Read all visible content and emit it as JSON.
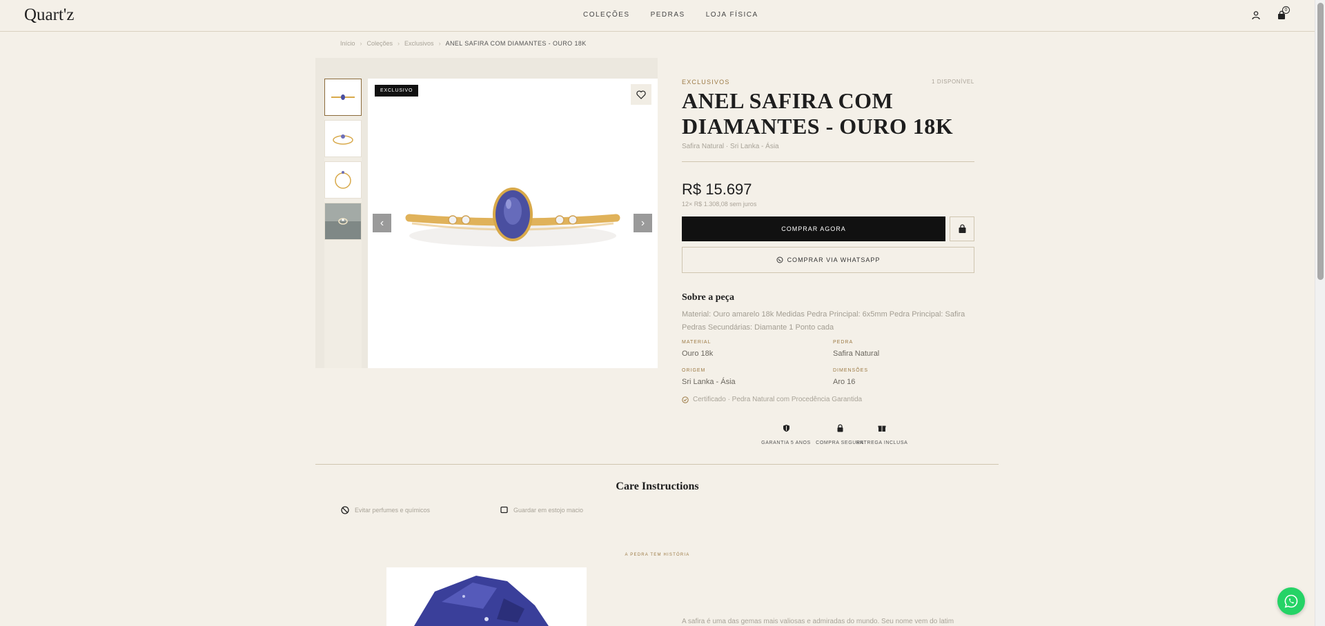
{
  "header": {
    "logo": "Quart'z",
    "nav": [
      "COLEÇÕES",
      "PEDRAS",
      "LOJA FÍSICA"
    ],
    "cart_count": "0"
  },
  "breadcrumb": {
    "items": [
      "Início",
      "Coleções",
      "Exclusivos"
    ],
    "current": "ANEL SAFIRA COM DIAMANTES - OURO 18K"
  },
  "gallery": {
    "badge": "EXCLUSIVO",
    "thumb_count": 4,
    "active_thumb": 1
  },
  "product": {
    "category": "EXCLUSIVOS",
    "availability": "1 DISPONÍVEL",
    "title": "ANEL SAFIRA COM DIAMANTES - OURO 18K",
    "subtitle": "Safira Natural · Sri Lanka - Ásia",
    "price": "R$ 15.697",
    "installments": "12× R$ 1.308,08 sem juros",
    "buy_label": "COMPRAR AGORA",
    "whatsapp_label": "COMPRAR VIA WHATSAPP",
    "about_heading": "Sobre a peça",
    "about_text": "Material: Ouro amarelo 18k Medidas Pedra Principal: 6x5mm Pedra Principal: Safira Pedras Secundárias: Diamante 1 Ponto cada",
    "specs": [
      {
        "label": "MATERIAL",
        "value": "Ouro 18k"
      },
      {
        "label": "PEDRA",
        "value": "Safira Natural"
      },
      {
        "label": "ORIGEM",
        "value": "Sri Lanka - Ásia"
      },
      {
        "label": "DIMENSÕES",
        "value": "Aro 16"
      }
    ],
    "certificate": "Certificado · Pedra Natural com Procedência Garantida",
    "features": [
      {
        "label": "GARANTIA 5 ANOS",
        "icon": "shield-icon"
      },
      {
        "label": "COMPRA SEGURA",
        "icon": "lock-icon"
      },
      {
        "label": "ENTREGA INCLUSA",
        "icon": "gift-icon"
      }
    ]
  },
  "care": {
    "heading": "Care Instructions",
    "items": [
      "Evitar perfumes e químicos",
      "Guardar em estojo macio"
    ]
  },
  "story": {
    "tag": "A PEDRA TEM HISTÓRIA",
    "text": "A safira é uma das gemas mais valiosas e admiradas do mundo. Seu nome vem do latim"
  },
  "colors": {
    "accent": "#9c7a45",
    "background": "#f4f0e8",
    "button": "#111111",
    "whatsapp": "#25d366",
    "sapphire": "#4a4fa0"
  }
}
